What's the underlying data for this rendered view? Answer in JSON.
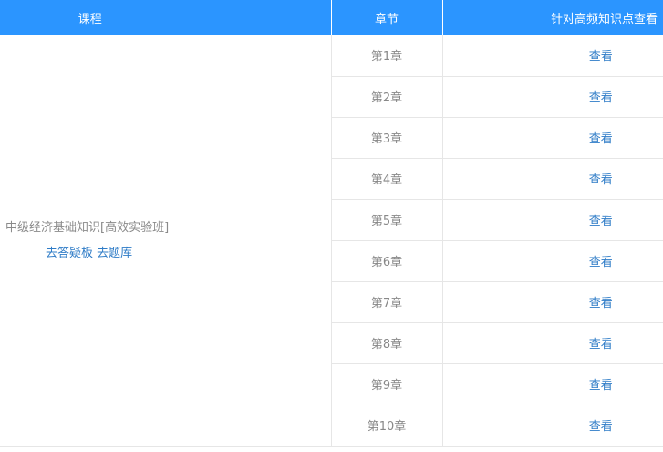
{
  "header": {
    "course": "课程",
    "chapter": "章节",
    "action": "针对高频知识点查看"
  },
  "course": {
    "name": "中级经济基础知识[高效实验班]",
    "qa_link": "去答疑板",
    "bank_link": "去题库"
  },
  "chapters": [
    {
      "label": "第1章",
      "action": "查看"
    },
    {
      "label": "第2章",
      "action": "查看"
    },
    {
      "label": "第3章",
      "action": "查看"
    },
    {
      "label": "第4章",
      "action": "查看"
    },
    {
      "label": "第5章",
      "action": "查看"
    },
    {
      "label": "第6章",
      "action": "查看"
    },
    {
      "label": "第7章",
      "action": "查看"
    },
    {
      "label": "第8章",
      "action": "查看"
    },
    {
      "label": "第9章",
      "action": "查看"
    },
    {
      "label": "第10章",
      "action": "查看"
    }
  ],
  "colors": {
    "header_bg": "#2b95ff",
    "link": "#2f7cc7",
    "muted_text": "#888888"
  }
}
